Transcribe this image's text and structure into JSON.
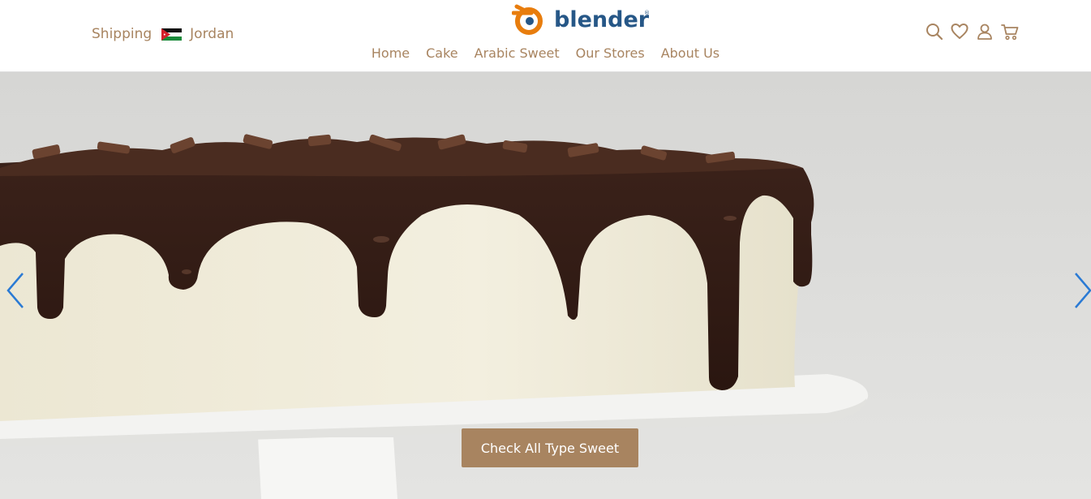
{
  "header": {
    "shipping_label": "Shipping",
    "country": "Jordan",
    "flag_icon": "jordan-flag-icon",
    "logo_text": "blender",
    "logo_mark": "®",
    "nav": [
      {
        "label": "Home"
      },
      {
        "label": "Cake"
      },
      {
        "label": "Arabic Sweet"
      },
      {
        "label": "Our Stores"
      },
      {
        "label": "About Us"
      }
    ],
    "icons": [
      "search-icon",
      "heart-icon",
      "user-icon",
      "cart-icon"
    ]
  },
  "hero": {
    "image": "chocolate-drip-cake",
    "cta_label": "Check All Type Sweet",
    "prev_icon": "chevron-left-icon",
    "next_icon": "chevron-right-icon"
  },
  "colors": {
    "accent": "#a88460",
    "logo_orange": "#e87d0d",
    "logo_blue": "#265787",
    "arrow_blue": "#2a7ad4"
  }
}
